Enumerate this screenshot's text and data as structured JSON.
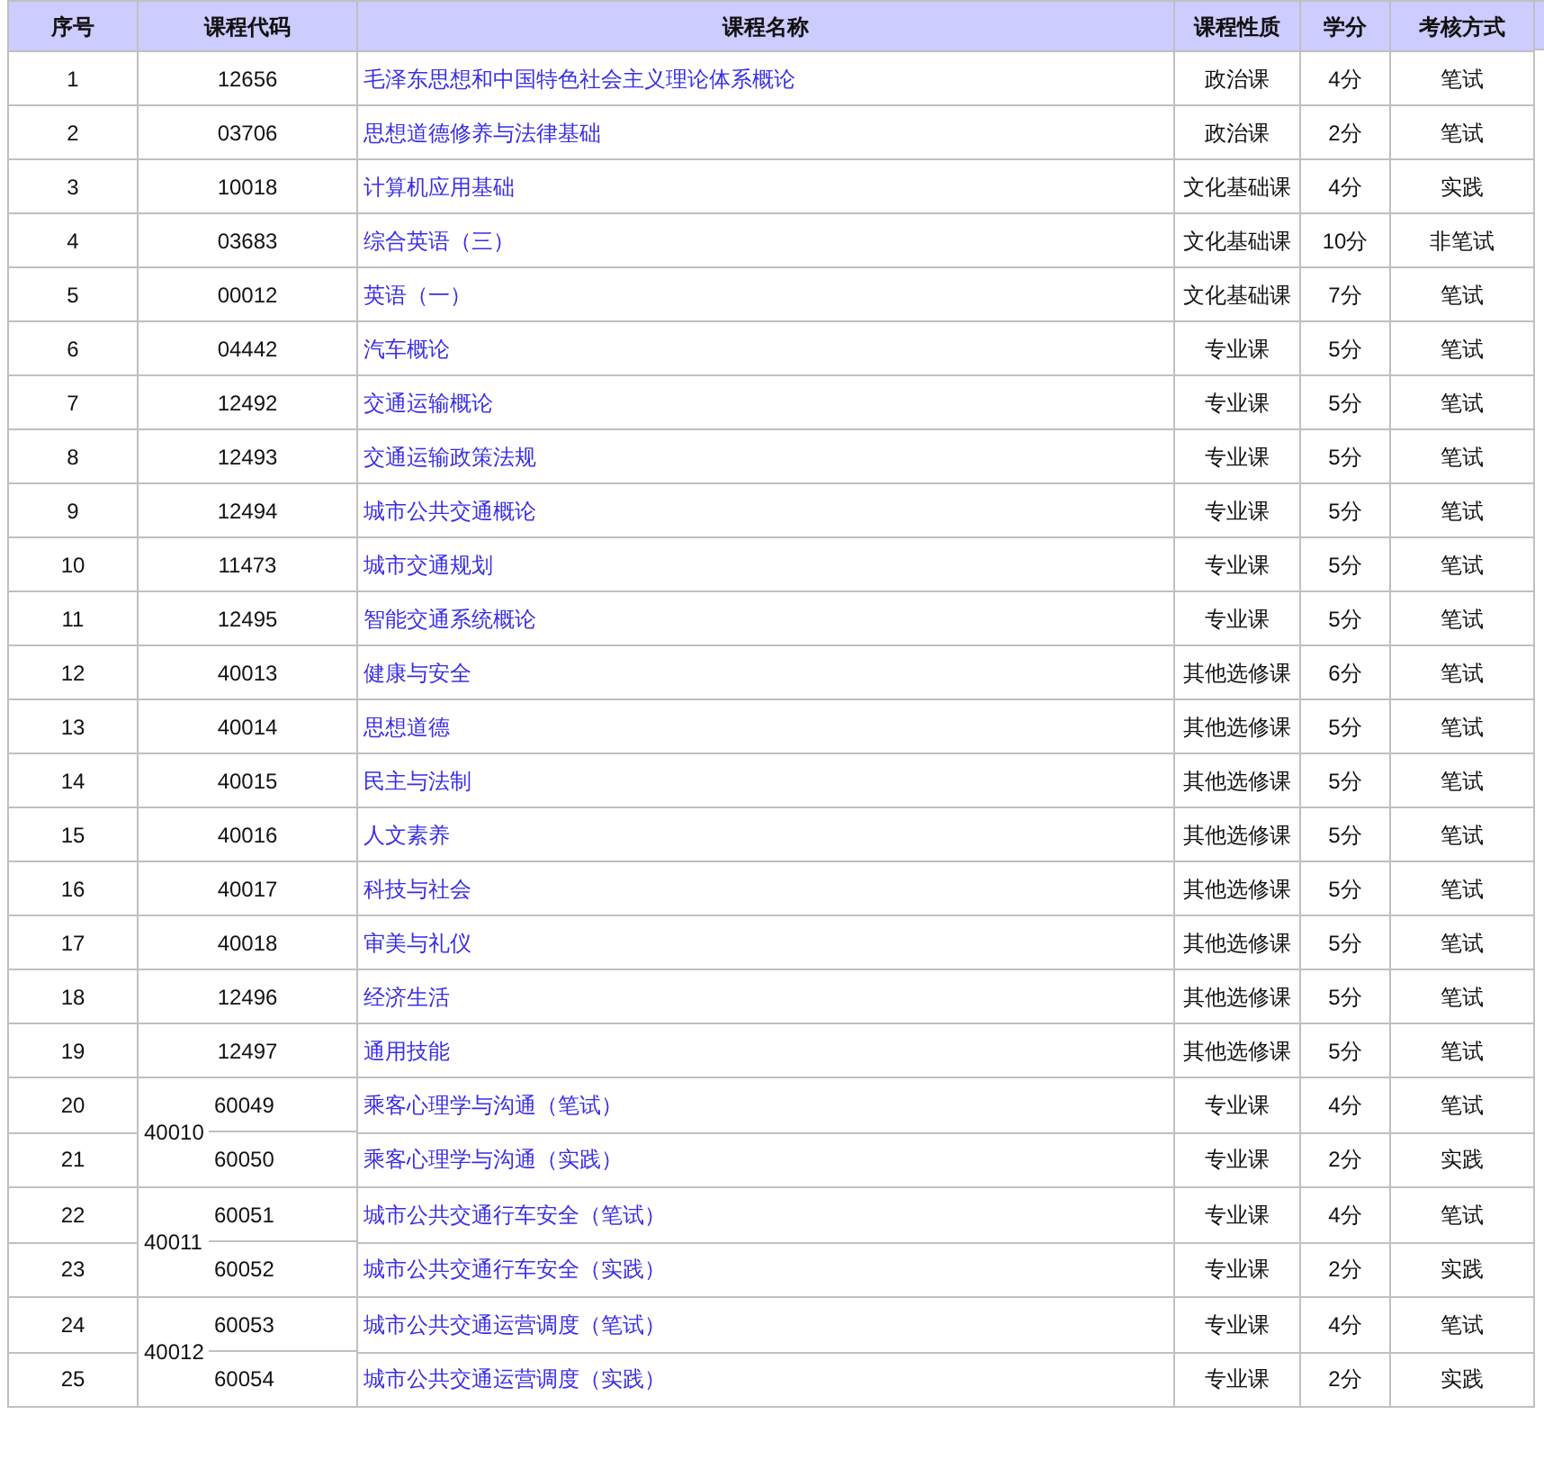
{
  "table": {
    "columns": [
      "序号",
      "课程代码",
      "课程名称",
      "课程性质",
      "学分",
      "考核方式"
    ],
    "rows": [
      {
        "kind": "single",
        "no": "1",
        "code": "12656",
        "name": "毛泽东思想和中国特色社会主义理论体系概论",
        "type": "政治课",
        "credits": "4分",
        "exam": "笔试"
      },
      {
        "kind": "single",
        "no": "2",
        "code": "03706",
        "name": "思想道德修养与法律基础",
        "type": "政治课",
        "credits": "2分",
        "exam": "笔试"
      },
      {
        "kind": "single",
        "no": "3",
        "code": "10018",
        "name": "计算机应用基础",
        "type": "文化基础课",
        "credits": "4分",
        "exam": "实践"
      },
      {
        "kind": "single",
        "no": "4",
        "code": "03683",
        "name": "综合英语（三）",
        "type": "文化基础课",
        "credits": "10分",
        "exam": "非笔试"
      },
      {
        "kind": "single",
        "no": "5",
        "code": "00012",
        "name": "英语（一）",
        "type": "文化基础课",
        "credits": "7分",
        "exam": "笔试"
      },
      {
        "kind": "single",
        "no": "6",
        "code": "04442",
        "name": "汽车概论",
        "type": "专业课",
        "credits": "5分",
        "exam": "笔试"
      },
      {
        "kind": "single",
        "no": "7",
        "code": "12492",
        "name": "交通运输概论",
        "type": "专业课",
        "credits": "5分",
        "exam": "笔试"
      },
      {
        "kind": "single",
        "no": "8",
        "code": "12493",
        "name": "交通运输政策法规",
        "type": "专业课",
        "credits": "5分",
        "exam": "笔试"
      },
      {
        "kind": "single",
        "no": "9",
        "code": "12494",
        "name": "城市公共交通概论",
        "type": "专业课",
        "credits": "5分",
        "exam": "笔试"
      },
      {
        "kind": "single",
        "no": "10",
        "code": "11473",
        "name": "城市交通规划",
        "type": "专业课",
        "credits": "5分",
        "exam": "笔试"
      },
      {
        "kind": "single",
        "no": "11",
        "code": "12495",
        "name": "智能交通系统概论",
        "type": "专业课",
        "credits": "5分",
        "exam": "笔试"
      },
      {
        "kind": "single",
        "no": "12",
        "code": "40013",
        "name": "健康与安全",
        "type": "其他选修课",
        "credits": "6分",
        "exam": "笔试"
      },
      {
        "kind": "single",
        "no": "13",
        "code": "40014",
        "name": "思想道德",
        "type": "其他选修课",
        "credits": "5分",
        "exam": "笔试"
      },
      {
        "kind": "single",
        "no": "14",
        "code": "40015",
        "name": "民主与法制",
        "type": "其他选修课",
        "credits": "5分",
        "exam": "笔试"
      },
      {
        "kind": "single",
        "no": "15",
        "code": "40016",
        "name": "人文素养",
        "type": "其他选修课",
        "credits": "5分",
        "exam": "笔试"
      },
      {
        "kind": "single",
        "no": "16",
        "code": "40017",
        "name": "科技与社会",
        "type": "其他选修课",
        "credits": "5分",
        "exam": "笔试"
      },
      {
        "kind": "single",
        "no": "17",
        "code": "40018",
        "name": "审美与礼仪",
        "type": "其他选修课",
        "credits": "5分",
        "exam": "笔试"
      },
      {
        "kind": "single",
        "no": "18",
        "code": "12496",
        "name": "经济生活",
        "type": "其他选修课",
        "credits": "5分",
        "exam": "笔试"
      },
      {
        "kind": "single",
        "no": "19",
        "code": "12497",
        "name": "通用技能",
        "type": "其他选修课",
        "credits": "5分",
        "exam": "笔试"
      },
      {
        "kind": "group",
        "code": "40010",
        "items": [
          {
            "no": "20",
            "code": "60049",
            "name": "乘客心理学与沟通（笔试）",
            "type": "专业课",
            "credits": "4分",
            "exam": "笔试"
          },
          {
            "no": "21",
            "code": "60050",
            "name": "乘客心理学与沟通（实践）",
            "type": "专业课",
            "credits": "2分",
            "exam": "实践"
          }
        ]
      },
      {
        "kind": "group",
        "code": "40011",
        "items": [
          {
            "no": "22",
            "code": "60051",
            "name": "城市公共交通行车安全（笔试）",
            "type": "专业课",
            "credits": "4分",
            "exam": "笔试"
          },
          {
            "no": "23",
            "code": "60052",
            "name": "城市公共交通行车安全（实践）",
            "type": "专业课",
            "credits": "2分",
            "exam": "实践"
          }
        ]
      },
      {
        "kind": "group",
        "code": "40012",
        "items": [
          {
            "no": "24",
            "code": "60053",
            "name": "城市公共交通运营调度（笔试）",
            "type": "专业课",
            "credits": "4分",
            "exam": "笔试"
          },
          {
            "no": "25",
            "code": "60054",
            "name": "城市公共交通运营调度（实践）",
            "type": "专业课",
            "credits": "2分",
            "exam": "实践"
          }
        ]
      }
    ]
  }
}
